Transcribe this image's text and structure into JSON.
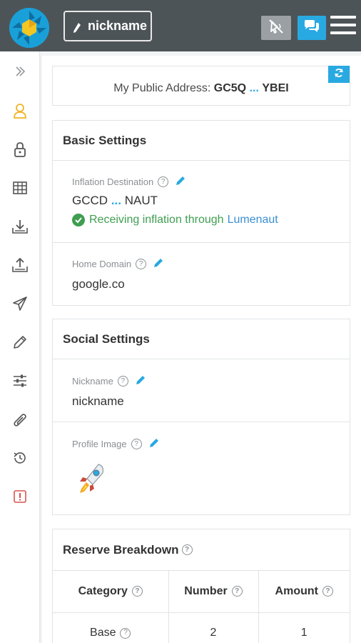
{
  "topbar": {
    "nickname_button": "nickname",
    "icons": [
      "logo-icon",
      "pencil-icon",
      "mute-icon",
      "chat-icon",
      "menu-icon"
    ]
  },
  "sidebar": {
    "items": [
      {
        "icon": "expand-icon"
      },
      {
        "icon": "user-icon",
        "active": true
      },
      {
        "icon": "lock-icon"
      },
      {
        "icon": "table-icon"
      },
      {
        "icon": "receive-icon"
      },
      {
        "icon": "send-icon"
      },
      {
        "icon": "paper-plane-icon"
      },
      {
        "icon": "pencil-icon"
      },
      {
        "icon": "sliders-icon"
      },
      {
        "icon": "paperclip-icon"
      },
      {
        "icon": "history-icon"
      },
      {
        "icon": "alert-icon"
      }
    ]
  },
  "address": {
    "label": "My Public Address:",
    "start": "GC5Q",
    "dots": "...",
    "end": "YBEI"
  },
  "basic_settings": {
    "title": "Basic Settings",
    "inflation": {
      "label": "Inflation Destination",
      "start": "GCCD",
      "dots": "...",
      "end": "NAUT",
      "status_text": "Receiving inflation through",
      "status_link": "Lumenaut"
    },
    "home_domain": {
      "label": "Home Domain",
      "value": "google.co"
    }
  },
  "social_settings": {
    "title": "Social Settings",
    "nickname": {
      "label": "Nickname",
      "value": "nickname"
    },
    "profile_image": {
      "label": "Profile Image",
      "image": "rocket-icon"
    }
  },
  "reserve": {
    "title": "Reserve Breakdown",
    "columns": [
      "Category",
      "Number",
      "Amount"
    ],
    "rows": [
      {
        "category": "Base",
        "number": "2",
        "amount": "1"
      }
    ]
  },
  "colors": {
    "topbar": "#4d5457",
    "accent": "#29a9e1",
    "success": "#3f9e50",
    "active_icon": "#f0b429",
    "alert": "#d9534f"
  }
}
